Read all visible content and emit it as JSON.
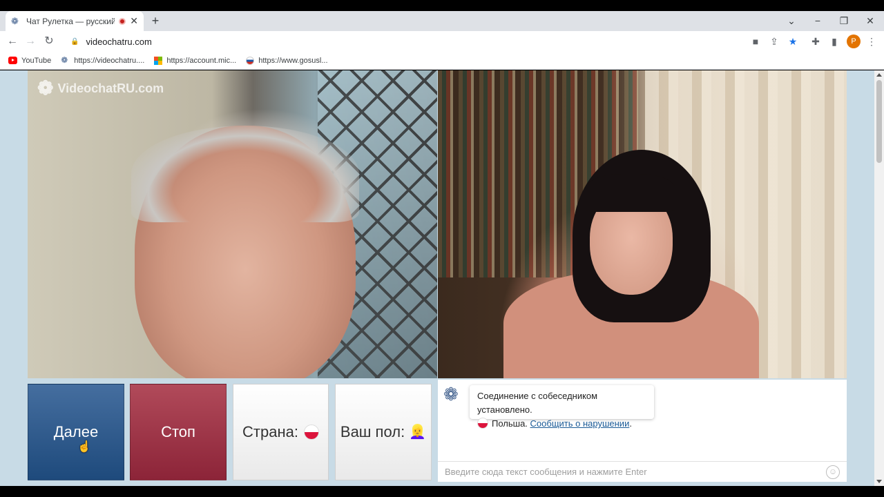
{
  "browser": {
    "tab_title": "Чат Рулетка — русский вид",
    "tab_close": "✕",
    "new_tab": "+",
    "url": "videochatru.com",
    "profile_initial": "P",
    "bookmarks": [
      {
        "label": "YouTube",
        "icon": "youtube-icon"
      },
      {
        "label": "https://videochatru....",
        "icon": "videochatru-icon"
      },
      {
        "label": "https://account.mic...",
        "icon": "microsoft-icon"
      },
      {
        "label": "https://www.gosusl...",
        "icon": "gosuslugi-icon"
      }
    ]
  },
  "page": {
    "watermark": "VideochatRU.com",
    "buttons": {
      "next": "Далее",
      "stop": "Стоп",
      "country": "Страна:",
      "gender": "Ваш пол:",
      "gender_emoji": "👱‍♀️"
    },
    "chat": {
      "message_connected": "Соединение с собеседником установлено.",
      "country_name": "Польша.",
      "report_link": "Сообщить о нарушении",
      "report_suffix": ".",
      "input_placeholder": "Введите сюда текст сообщения и нажмите Enter"
    }
  },
  "colors": {
    "next_button": "#2f5a8c",
    "stop_button": "#9e3447",
    "page_background": "#c8dbe6"
  }
}
